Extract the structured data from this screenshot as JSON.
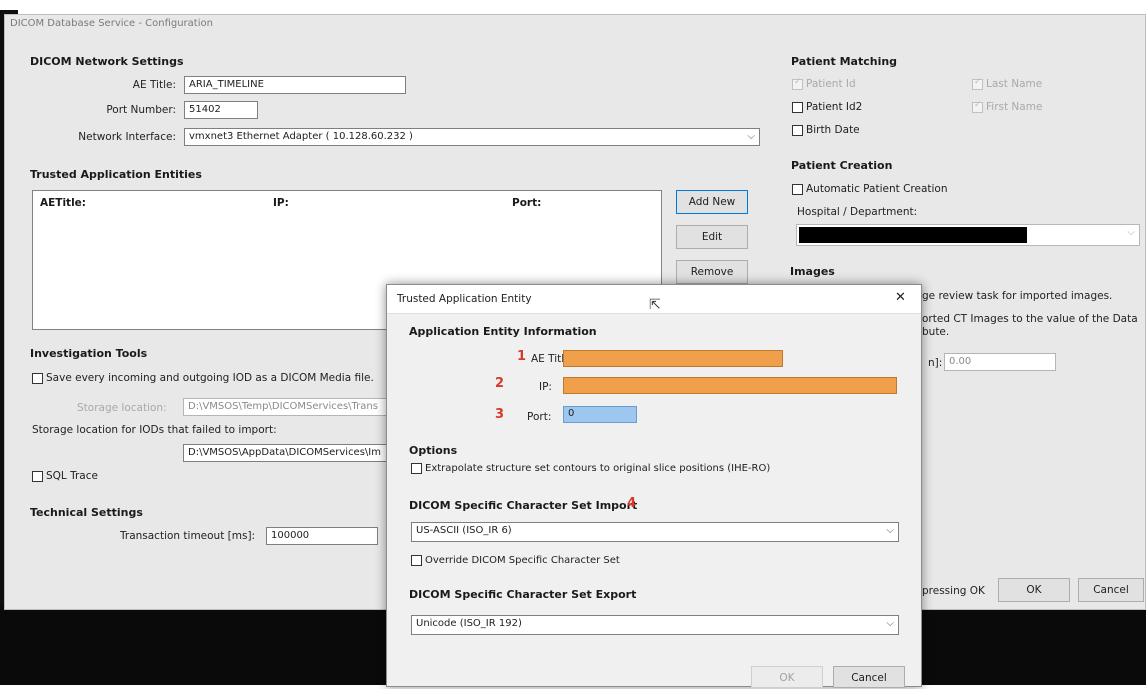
{
  "window_title": "DICOM Database Service - Configuration",
  "network": {
    "header": "DICOM Network Settings",
    "ae_title_label": "AE Title:",
    "ae_title_value": "ARIA_TIMELINE",
    "port_label": "Port Number:",
    "port_value": "51402",
    "iface_label": "Network Interface:",
    "iface_value": "vmxnet3 Ethernet Adapter ( 10.128.60.232 )"
  },
  "trusted": {
    "header": "Trusted Application Entities",
    "columns": [
      "AETitle:",
      "IP:",
      "Port:"
    ],
    "add_new": "Add New",
    "edit": "Edit",
    "remove": "Remove"
  },
  "investigation": {
    "header": "Investigation Tools",
    "save_iod_label": "Save every incoming and outgoing IOD as a DICOM Media file.",
    "storage_location_label": "Storage location:",
    "storage_location_value": "D:\\VMSOS\\Temp\\DICOMServices\\Trans",
    "failed_label": "Storage location for IODs that failed to import:",
    "failed_value": "D:\\VMSOS\\AppData\\DICOMServices\\Im",
    "sql_trace": "SQL Trace"
  },
  "technical": {
    "header": "Technical Settings",
    "timeout_label": "Transaction timeout [ms]:",
    "timeout_value": "100000"
  },
  "patient_matching": {
    "header": "Patient Matching",
    "patient_id": "Patient Id",
    "last_name": "Last Name",
    "patient_id2": "Patient Id2",
    "first_name": "First Name",
    "birth_date": "Birth Date"
  },
  "patient_creation": {
    "header": "Patient Creation",
    "auto_label": "Automatic Patient Creation",
    "hospital_label": "Hospital / Department:"
  },
  "images": {
    "header": "Images",
    "line1": "ge review task for imported images.",
    "line2": "orted CT Images to the value of the Data",
    "line3": "bute.",
    "field_label": "n]:",
    "field_value": "0.00"
  },
  "main_footer": {
    "note": "pressing OK",
    "ok": "OK",
    "cancel": "Cancel"
  },
  "dialog": {
    "title": "Trusted Application Entity",
    "close": "✕",
    "section1": "Application Entity Information",
    "ae_title_label": "AE Title:",
    "ip_label": "IP:",
    "port_label": "Port:",
    "port_value": "0",
    "num1": "1",
    "num2": "2",
    "num3": "3",
    "num4": "4",
    "options_header": "Options",
    "extrapolate": "Extrapolate structure set contours to original slice positions (IHE-RO)",
    "charset_import_header": "DICOM Specific Character Set Import",
    "charset_import_value": "US-ASCII (ISO_IR 6)",
    "override_label": "Override DICOM Specific Character Set",
    "charset_export_header": "DICOM Specific Character Set Export",
    "charset_export_value": "Unicode (ISO_IR 192)",
    "ok": "OK",
    "cancel": "Cancel"
  },
  "colors": {
    "highlight_orange": "#f0a04a",
    "highlight_blue": "#9ec7ef",
    "annotation_red": "#d83a2a"
  }
}
